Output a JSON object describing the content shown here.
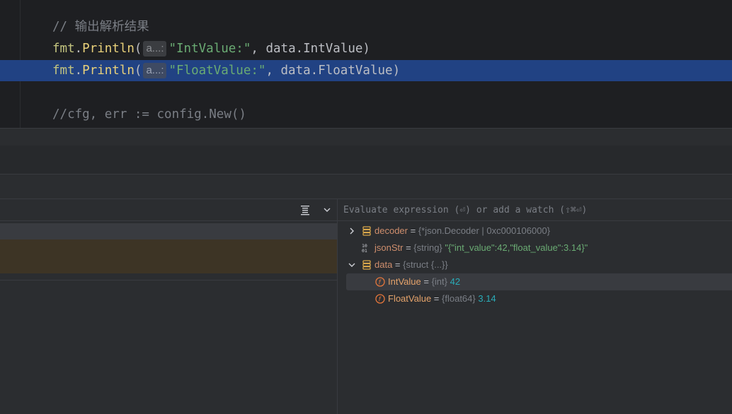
{
  "editor": {
    "lines": [
      {
        "comment": "// 输出解析结果"
      },
      {
        "pkg": "fmt",
        "dot": ".",
        "fn": "Println",
        "open": "(",
        "hint": "a...:",
        "str": "\"IntValue:\"",
        "rest": ", data.IntValue)"
      },
      {
        "pkg": "fmt",
        "dot": ".",
        "fn": "Println",
        "open": "(",
        "hint": "a...:",
        "str": "\"FloatValue:\"",
        "rest": ", data.FloatValue)"
      },
      {
        "comment": "//cfg, err := config.New()"
      }
    ]
  },
  "frames_panel": {
    "filter_icon": "filter-list-icon",
    "chevron_icon": "chevron-down-icon"
  },
  "variables": {
    "eval_placeholder": "Evaluate expression (⏎) or add a watch (⇧⌘⏎)",
    "items": [
      {
        "name": "decoder",
        "eq": " = ",
        "type": "{*json.Decoder | 0xc000106000}",
        "value": "",
        "icon": "struct-icon",
        "expand": "chevron-right-icon"
      },
      {
        "name": "jsonStr",
        "eq": " = ",
        "type": "{string}",
        "value": "\"{\"int_value\":42,\"float_value\":3.14}\"",
        "icon": "binary-icon"
      },
      {
        "name": "data",
        "eq": " = ",
        "type": "{struct {...}}",
        "value": "",
        "icon": "struct-icon",
        "expand": "chevron-down-icon"
      },
      {
        "name": "IntValue",
        "eq": " = ",
        "type": "{int}",
        "value": "42",
        "icon": "field-icon"
      },
      {
        "name": "FloatValue",
        "eq": " = ",
        "type": "{float64}",
        "value": "3.14",
        "icon": "field-icon"
      }
    ]
  },
  "colors": {
    "editor_bg": "#1e1f22",
    "selection": "#214283",
    "string": "#6aab73",
    "number": "#2aacb8",
    "field": "#e5a36b"
  }
}
